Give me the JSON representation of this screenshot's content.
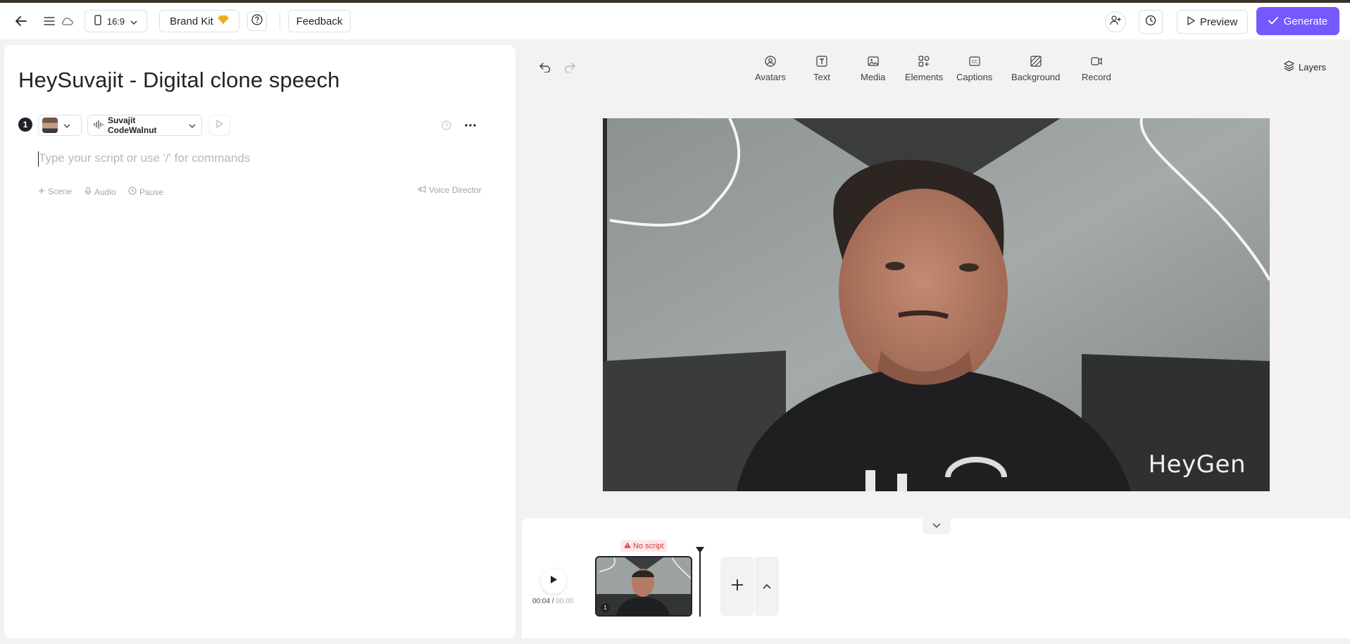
{
  "toolbar": {
    "aspect_ratio": "16:9",
    "brand_kit_label": "Brand Kit",
    "feedback_label": "Feedback",
    "preview_label": "Preview",
    "generate_label": "Generate",
    "accent_color": "#7559ff"
  },
  "script_panel": {
    "title": "HeySuvajit - Digital clone speech",
    "scene_number": "1",
    "voice_name": "Suvajit CodeWalnut",
    "script_placeholder": "Type your script or use '/' for commands",
    "actions": {
      "scene": "Scene",
      "audio": "Audio",
      "pause": "Pause",
      "voice_director": "Voice Director"
    }
  },
  "canvas_tools": [
    {
      "label": "Avatars",
      "icon": "avatar-icon"
    },
    {
      "label": "Text",
      "icon": "text-icon"
    },
    {
      "label": "Media",
      "icon": "media-icon"
    },
    {
      "label": "Elements",
      "icon": "elements-icon"
    },
    {
      "label": "Captions",
      "icon": "captions-icon"
    },
    {
      "label": "Background",
      "icon": "background-icon"
    },
    {
      "label": "Record",
      "icon": "record-icon"
    }
  ],
  "layers_label": "Layers",
  "video": {
    "watermark": "HeyGen"
  },
  "timeline": {
    "current_time": "00:04",
    "separator": " / ",
    "total_time": "00:00",
    "no_script_badge": "No script",
    "clip_number": "1"
  }
}
